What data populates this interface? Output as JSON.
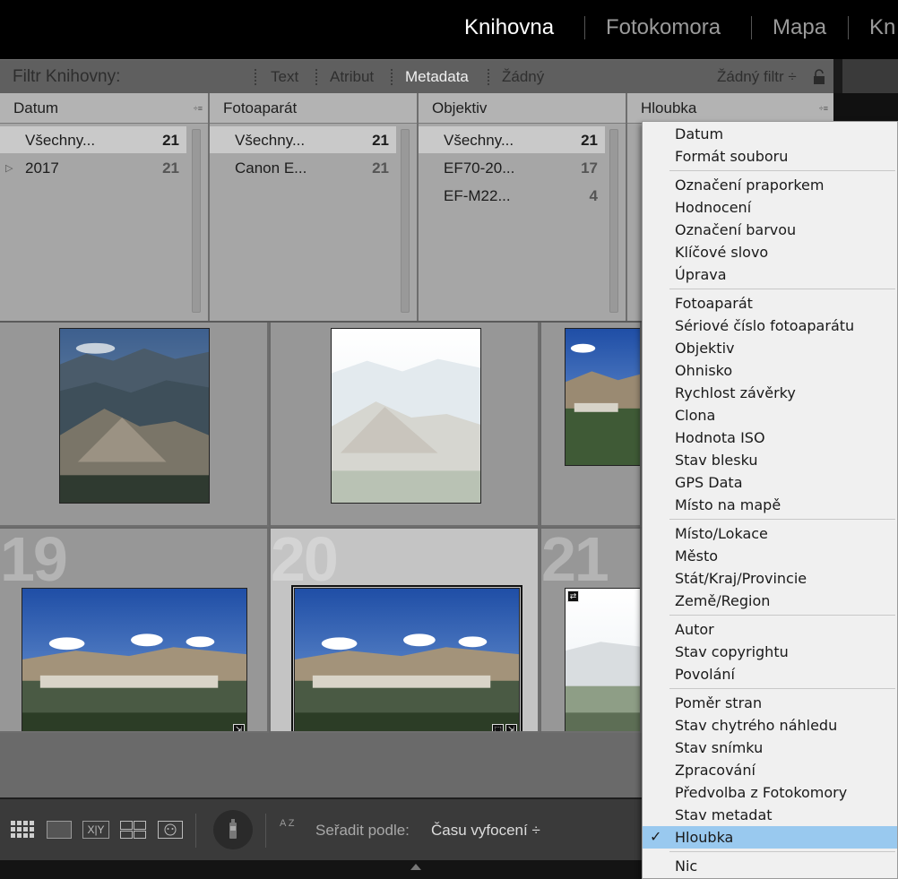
{
  "modules": [
    "Knihovna",
    "Fotokomora",
    "Mapa",
    "Kn"
  ],
  "filter_bar": {
    "title": "Filtr Knihovny:",
    "tabs": [
      "Text",
      "Atribut",
      "Metadata",
      "Žádný"
    ],
    "active_tab": "Metadata",
    "preset": "Žádný filtr ÷"
  },
  "columns": [
    {
      "header": "Datum",
      "rows": [
        {
          "label": "Všechny...",
          "count": "21",
          "selected": true
        },
        {
          "label": "2017",
          "count": "21",
          "selected": false,
          "expandable": true
        }
      ]
    },
    {
      "header": "Fotoaparát",
      "rows": [
        {
          "label": "Všechny...",
          "count": "21",
          "selected": true
        },
        {
          "label": "Canon E...",
          "count": "21",
          "selected": false
        }
      ]
    },
    {
      "header": "Objektiv",
      "rows": [
        {
          "label": "Všechny...",
          "count": "21",
          "selected": true
        },
        {
          "label": "EF70-20...",
          "count": "17",
          "selected": false
        },
        {
          "label": "EF-M22...",
          "count": "4",
          "selected": false
        }
      ]
    },
    {
      "header": "Hloubka",
      "rows": []
    }
  ],
  "grid": {
    "cell_numbers": [
      "19",
      "20",
      "21"
    ]
  },
  "toolbar": {
    "sort_label": "Seřadit podle:",
    "sort_value": "Času vyfocení ÷",
    "sort_az_icon": "A Z"
  },
  "menu": {
    "items": [
      "Datum",
      "Formát souboru",
      "Označení praporkem",
      "Hodnocení",
      "Označení barvou",
      "Klíčové slovo",
      "Úprava",
      "Fotoaparát",
      "Sériové číslo fotoaparátu",
      "Objektiv",
      "Ohnisko",
      "Rychlost závěrky",
      "Clona",
      "Hodnota ISO",
      "Stav blesku",
      "GPS Data",
      "Místo na mapě",
      "Místo/Lokace",
      "Město",
      "Stát/Kraj/Provincie",
      "Země/Region",
      "Autor",
      "Stav copyrightu",
      "Povolání",
      "Poměr stran",
      "Stav chytrého náhledu",
      "Stav snímku",
      "Zpracování",
      "Předvolba z Fotokomory",
      "Stav metadat",
      "Hloubka",
      "Nic"
    ],
    "checked_item": "Hloubka"
  }
}
